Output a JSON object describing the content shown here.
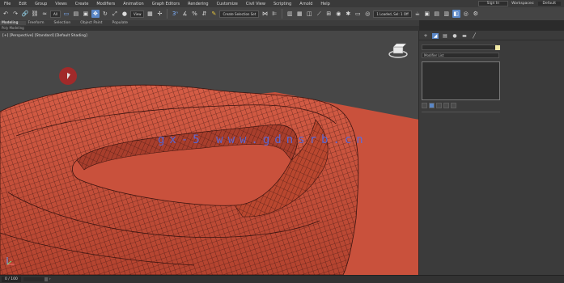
{
  "menu": {
    "items": [
      "File",
      "Edit",
      "Group",
      "Views",
      "Create",
      "Modifiers",
      "Animation",
      "Graph Editors",
      "Rendering",
      "Customize",
      "Civil View",
      "Scripting",
      "Arnold",
      "Help"
    ],
    "sign_in": "Sign In",
    "workspaces_label": "Workspaces:",
    "workspaces_value": "Default"
  },
  "toolbar": {
    "filter_value": "All",
    "view_value": "View",
    "selection_set_placeholder": "Create Selection Set",
    "status_dropdown": "1 Loaded, Sel: 1 Off"
  },
  "ribbon": {
    "tabs": [
      "Modeling",
      "Freeform",
      "Selection",
      "Object Paint",
      "Populate"
    ],
    "active_tab": "Modeling",
    "sub_label": "Poly Modeling"
  },
  "viewport": {
    "label": "[+] [Perspective] [Standard] [Default Shading]",
    "watermark": "gx-5 www.gdnsrb.cn"
  },
  "command_panel": {
    "modifier_list": "Modifier List"
  },
  "status": {
    "frame": "0 / 100"
  },
  "colors": {
    "model": "#c9513c",
    "selection_highlight": "#5a87c7",
    "viewport_bg": "#474747",
    "watermark": "#4f6ff0"
  },
  "icons": [
    "undo-icon",
    "redo-icon",
    "link-icon",
    "unlink-icon",
    "bind-icon",
    "select-icon",
    "move-icon",
    "rotate-icon",
    "scale-icon",
    "snap-icon",
    "mirror-icon",
    "align-icon",
    "layer-icon",
    "graph-icon",
    "material-icon",
    "render-icon",
    "teapot-icon",
    "create-tab-icon",
    "modify-tab-icon",
    "hierarchy-tab-icon",
    "motion-tab-icon",
    "display-tab-icon",
    "utilities-tab-icon"
  ]
}
